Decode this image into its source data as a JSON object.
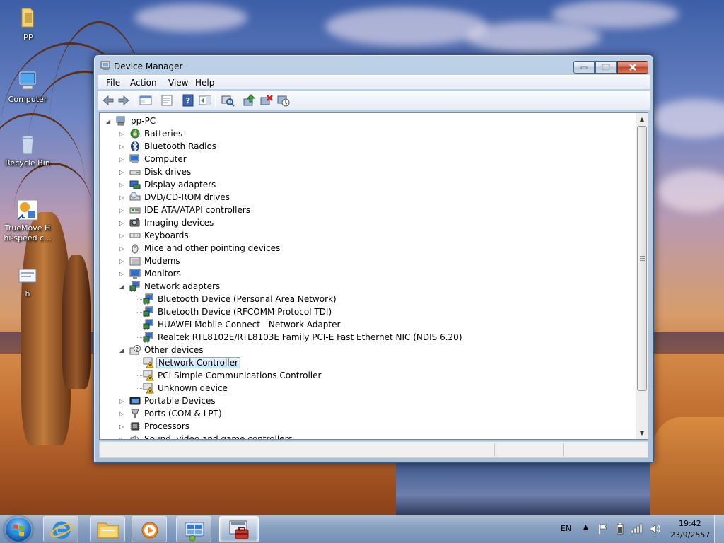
{
  "desktop": {
    "icons": [
      {
        "label": "pp"
      },
      {
        "label": "Computer"
      },
      {
        "label": "Recycle Bin"
      },
      {
        "label": "TrueMove H hi-speed c..."
      },
      {
        "label": "h"
      }
    ]
  },
  "window": {
    "title": "Device Manager",
    "menu": [
      "File",
      "Action",
      "View",
      "Help"
    ],
    "toolbar_icons": [
      "back-arrow-icon",
      "forward-arrow-icon",
      "show-hide-console-tree-icon",
      "properties-icon",
      "help-icon",
      "action-pane-icon",
      "scan-hardware-icon",
      "update-driver-icon",
      "uninstall-icon",
      "disable-icon"
    ]
  },
  "tree": {
    "root": "pp-PC",
    "categories": [
      {
        "label": "Batteries",
        "icon": "battery-icon",
        "expanded": false
      },
      {
        "label": "Bluetooth Radios",
        "icon": "bluetooth-icon",
        "expanded": false
      },
      {
        "label": "Computer",
        "icon": "computer-icon",
        "expanded": false
      },
      {
        "label": "Disk drives",
        "icon": "disk-drive-icon",
        "expanded": false
      },
      {
        "label": "Display adapters",
        "icon": "display-adapter-icon",
        "expanded": false
      },
      {
        "label": "DVD/CD-ROM drives",
        "icon": "dvd-drive-icon",
        "expanded": false
      },
      {
        "label": "IDE ATA/ATAPI controllers",
        "icon": "ide-controller-icon",
        "expanded": false
      },
      {
        "label": "Imaging devices",
        "icon": "camera-icon",
        "expanded": false
      },
      {
        "label": "Keyboards",
        "icon": "keyboard-icon",
        "expanded": false
      },
      {
        "label": "Mice and other pointing devices",
        "icon": "mouse-icon",
        "expanded": false
      },
      {
        "label": "Modems",
        "icon": "modem-icon",
        "expanded": false
      },
      {
        "label": "Monitors",
        "icon": "monitor-icon",
        "expanded": false
      },
      {
        "label": "Network adapters",
        "icon": "network-adapter-icon",
        "expanded": true,
        "children": [
          {
            "label": "Bluetooth Device (Personal Area Network)",
            "icon": "network-adapter-icon"
          },
          {
            "label": "Bluetooth Device (RFCOMM Protocol TDI)",
            "icon": "network-adapter-icon"
          },
          {
            "label": "HUAWEI Mobile Connect - Network Adapter",
            "icon": "network-adapter-icon"
          },
          {
            "label": "Realtek RTL8102E/RTL8103E Family PCI-E Fast Ethernet NIC (NDIS 6.20)",
            "icon": "network-adapter-icon"
          }
        ]
      },
      {
        "label": "Other devices",
        "icon": "unknown-device-icon",
        "expanded": true,
        "children": [
          {
            "label": "Network Controller",
            "icon": "warning-device-icon",
            "selected": true
          },
          {
            "label": "PCI Simple Communications Controller",
            "icon": "warning-device-icon"
          },
          {
            "label": "Unknown device",
            "icon": "warning-device-icon"
          }
        ]
      },
      {
        "label": "Portable Devices",
        "icon": "portable-device-icon",
        "expanded": false
      },
      {
        "label": "Ports (COM & LPT)",
        "icon": "port-icon",
        "expanded": false
      },
      {
        "label": "Processors",
        "icon": "processor-icon",
        "expanded": false
      },
      {
        "label": "Sound, video and game controllers",
        "icon": "sound-icon",
        "expanded": false
      }
    ]
  },
  "taskbar": {
    "language": "EN",
    "time": "19:42",
    "date": "23/9/2557",
    "tasks": [
      "internet-explorer-icon",
      "windows-explorer-icon",
      "media-player-icon",
      "network-center-icon",
      "device-manager-icon"
    ]
  }
}
